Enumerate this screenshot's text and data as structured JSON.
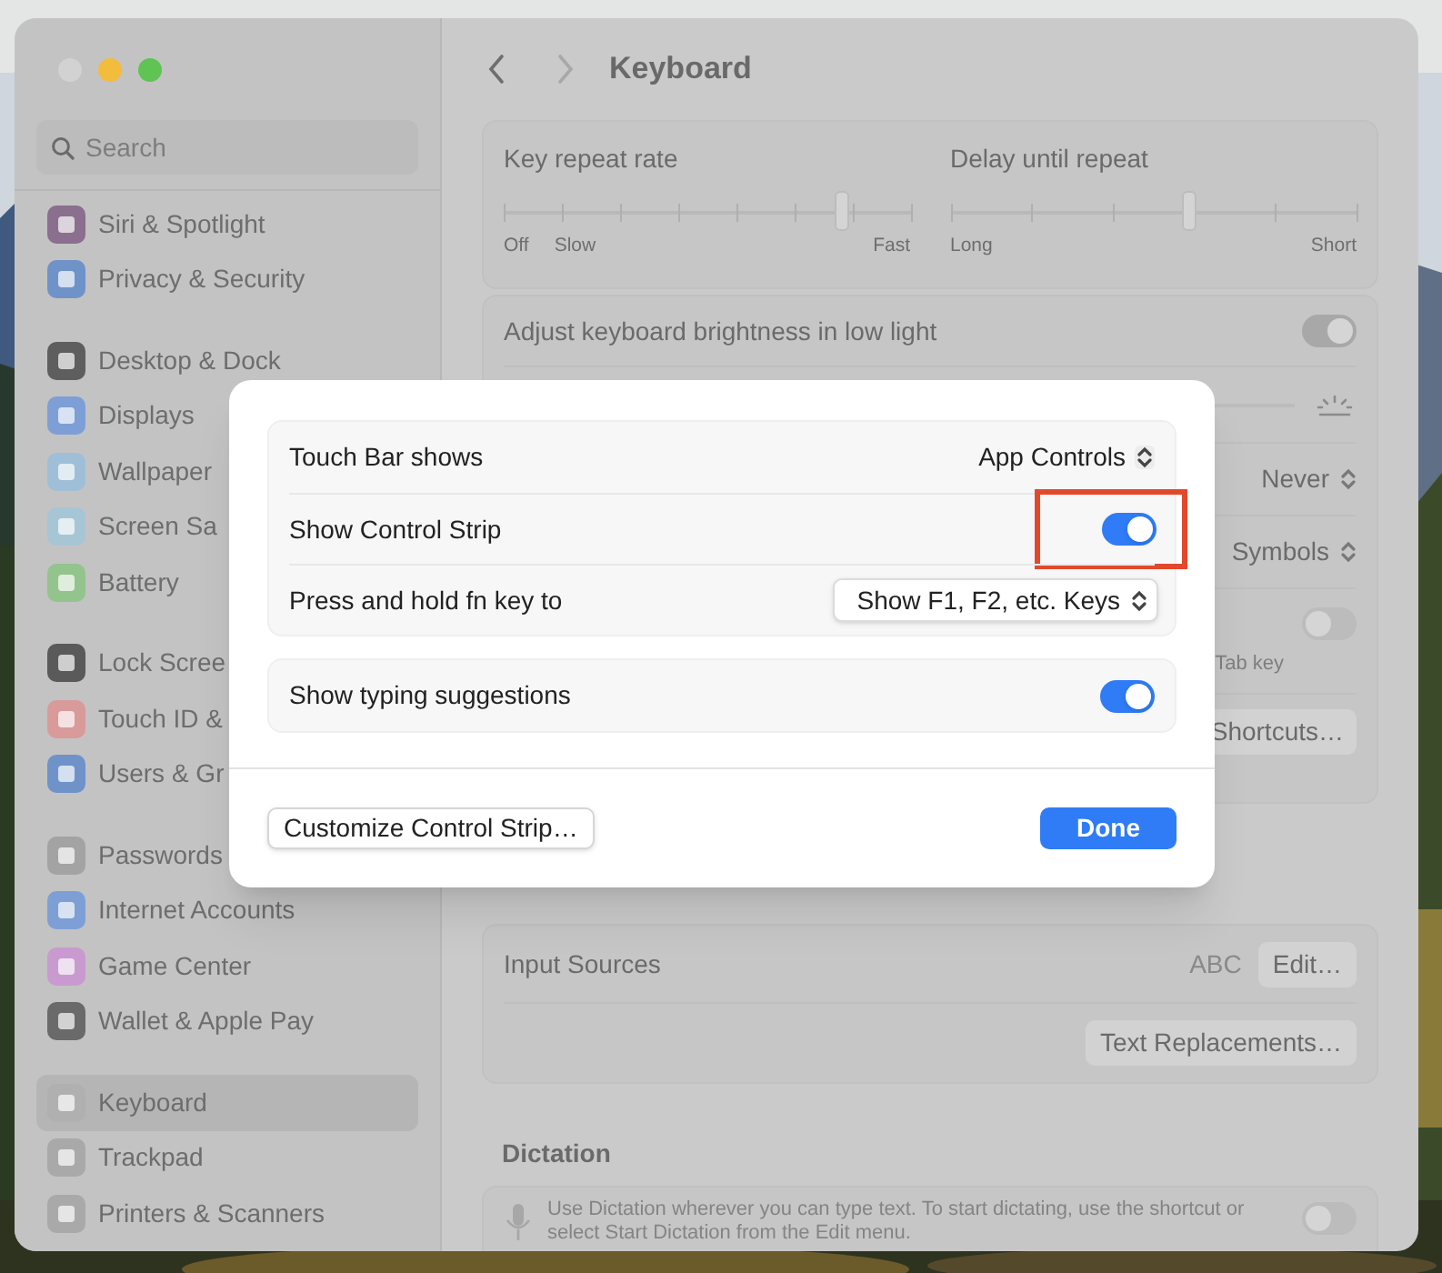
{
  "sidebar": {
    "search": {
      "placeholder": "Search"
    },
    "groups": [
      [
        {
          "label": "Siri & Spotlight",
          "color": "#8a6f8e",
          "selected": false
        },
        {
          "label": "Privacy & Security",
          "color": "#6f93c9",
          "selected": false
        }
      ],
      [
        {
          "label": "Desktop & Dock",
          "color": "#5e5e5e",
          "selected": false
        },
        {
          "label": "Displays",
          "color": "#7e9fd6",
          "selected": false
        },
        {
          "label": "Wallpaper",
          "color": "#9fbfd8",
          "selected": false
        },
        {
          "label": "Screen Sa",
          "color": "#a6c6d6",
          "selected": false
        },
        {
          "label": "Battery",
          "color": "#93c48d",
          "selected": false
        }
      ],
      [
        {
          "label": "Lock Scree",
          "color": "#5a5a5a",
          "selected": false
        },
        {
          "label": "Touch ID &",
          "color": "#d99a9a",
          "selected": false
        },
        {
          "label": "Users & Gr",
          "color": "#6f93c9",
          "selected": false
        }
      ],
      [
        {
          "label": "Passwords",
          "color": "#a3a3a3",
          "selected": false
        },
        {
          "label": "Internet Accounts",
          "color": "#7e9fd6",
          "selected": false
        },
        {
          "label": "Game Center",
          "color": "#c99ad0",
          "selected": false
        },
        {
          "label": "Wallet & Apple Pay",
          "color": "#6a6a6a",
          "selected": false
        }
      ],
      [
        {
          "label": "Keyboard",
          "color": "#b0b0b0",
          "selected": true
        },
        {
          "label": "Trackpad",
          "color": "#a9a9a9",
          "selected": false
        },
        {
          "label": "Printers & Scanners",
          "color": "#a9a9a9",
          "selected": false
        }
      ]
    ]
  },
  "toolbar": {
    "title": "Keyboard"
  },
  "sliders": [
    {
      "label": "Key repeat rate",
      "level": 0.83,
      "ticks": [
        "Off",
        "Slow",
        "Fast"
      ]
    },
    {
      "label": "Delay until repeat",
      "level": 0.59,
      "ticks": [
        "Long",
        "Short"
      ]
    }
  ],
  "settings": [
    {
      "kind": "toggle",
      "label": "Adjust keyboard brightness in low light",
      "on": true
    },
    {
      "kind": "brightness"
    },
    {
      "kind": "popup",
      "value": "Never"
    },
    {
      "kind": "popup",
      "value": "Symbols"
    },
    {
      "kind": "toggle",
      "note": "Tab key",
      "on": false
    },
    {
      "kind": "button",
      "value": "Shortcuts…"
    }
  ],
  "text_input": [
    {
      "kind": "sources",
      "label": "Input Sources",
      "value": "ABC",
      "button": "Edit…"
    },
    {
      "kind": "button",
      "value": "Text Replacements…"
    }
  ],
  "dictation": {
    "title": "Dictation",
    "text": "Use Dictation wherever you can type text. To start dictating, use the shortcut or select Start Dictation from the Edit menu.",
    "on": false
  },
  "dialog": {
    "groups": [
      [
        {
          "kind": "popup",
          "label": "Touch Bar shows",
          "value": "App Controls"
        },
        {
          "kind": "toggle",
          "label": "Show Control Strip",
          "on": true,
          "highlighted": true
        },
        {
          "kind": "menu",
          "label": "Press and hold fn key to",
          "value": "Show F1, F2, etc. Keys"
        }
      ],
      [
        {
          "kind": "toggle",
          "label": "Show typing suggestions",
          "on": true,
          "highlighted": false
        }
      ]
    ],
    "buttons": [
      {
        "label": "Customize Control Strip…",
        "default": false
      },
      {
        "label": "Done",
        "default": true
      }
    ]
  }
}
